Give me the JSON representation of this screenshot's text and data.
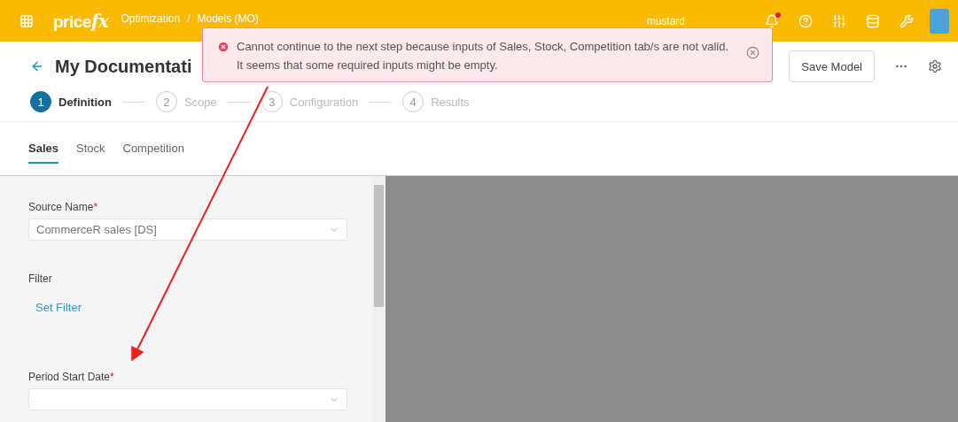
{
  "topbar": {
    "logo": {
      "main": "price",
      "accent": "fx"
    },
    "breadcrumb": [
      "Optimization",
      "/",
      "Models (MO)"
    ],
    "user": "mustard",
    "has_notification": true
  },
  "header": {
    "title": "My Documentati",
    "buttons": [
      "Save Model"
    ]
  },
  "steps": [
    {
      "number": "1",
      "label": "Definition",
      "selected": true
    },
    {
      "number": "2",
      "label": "Scope",
      "selected": false
    },
    {
      "number": "3",
      "label": "Configuration",
      "selected": false
    },
    {
      "number": "4",
      "label": "Results",
      "selected": false
    }
  ],
  "tabs": [
    {
      "label": "Sales",
      "selected": true
    },
    {
      "label": "Stock",
      "selected": false
    },
    {
      "label": "Competition",
      "selected": false
    }
  ],
  "form": [
    {
      "kind": "select",
      "label": "Source Name",
      "required": "*",
      "value": "CommerceR sales [DS]"
    },
    {
      "kind": "link",
      "label": "Filter",
      "link": "Set Filter"
    },
    {
      "kind": "select",
      "label": "Period Start Date",
      "required": "*"
    }
  ],
  "toast": {
    "kind": "error",
    "message": "Cannot continue to the next step because inputs of Sales, Stock, Competition tab/s are not valid. It seems that some required inputs might be empty."
  }
}
